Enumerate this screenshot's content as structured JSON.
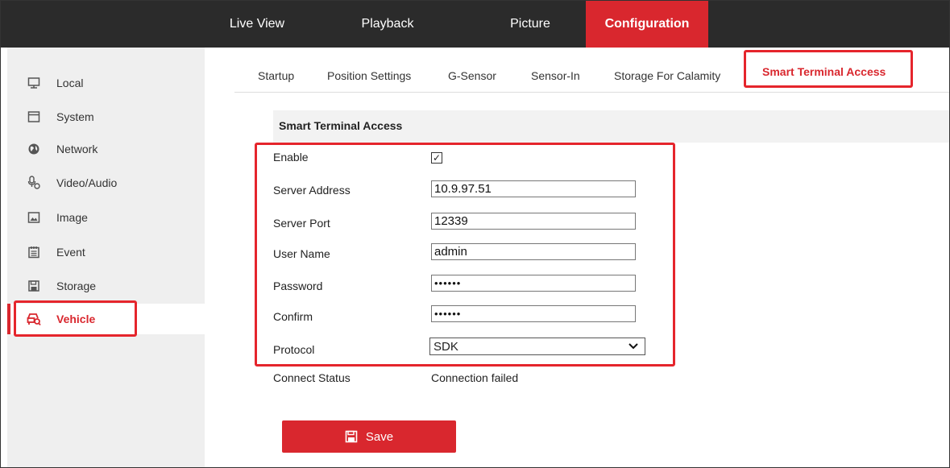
{
  "top_nav": {
    "items": [
      {
        "label": "Live View"
      },
      {
        "label": "Playback"
      },
      {
        "label": "Picture"
      },
      {
        "label": "Configuration",
        "active": true
      }
    ],
    "accent_color": "#d9272e",
    "bg_color": "#2b2b2b"
  },
  "sidebar": {
    "items": [
      {
        "label": "Local",
        "icon": "monitor-icon"
      },
      {
        "label": "System",
        "icon": "window-icon"
      },
      {
        "label": "Network",
        "icon": "globe-icon"
      },
      {
        "label": "Video/Audio",
        "icon": "microphone-icon"
      },
      {
        "label": "Image",
        "icon": "image-icon"
      },
      {
        "label": "Event",
        "icon": "calendar-icon"
      },
      {
        "label": "Storage",
        "icon": "floppy-icon"
      },
      {
        "label": "Vehicle",
        "icon": "vehicle-search-icon",
        "active": true
      }
    ]
  },
  "sub_tabs": {
    "items": [
      {
        "label": "Startup"
      },
      {
        "label": "Position Settings"
      },
      {
        "label": "G-Sensor"
      },
      {
        "label": "Sensor-In"
      },
      {
        "label": "Storage For Calamity"
      },
      {
        "label": "Smart Terminal Access",
        "active": true
      }
    ]
  },
  "section": {
    "title": "Smart Terminal Access"
  },
  "form": {
    "enable": {
      "label": "Enable",
      "checked": true,
      "check_mark": "✓"
    },
    "server_address": {
      "label": "Server Address",
      "value": "10.9.97.51"
    },
    "server_port": {
      "label": "Server Port",
      "value": "12339"
    },
    "user_name": {
      "label": "User Name",
      "value": "admin"
    },
    "password": {
      "label": "Password",
      "value": "••••••"
    },
    "confirm": {
      "label": "Confirm",
      "value": "••••••"
    },
    "protocol": {
      "label": "Protocol",
      "value": "SDK"
    },
    "connect_status": {
      "label": "Connect Status",
      "value": "Connection failed"
    }
  },
  "save_button": {
    "label": "Save",
    "icon": "floppy-icon"
  }
}
